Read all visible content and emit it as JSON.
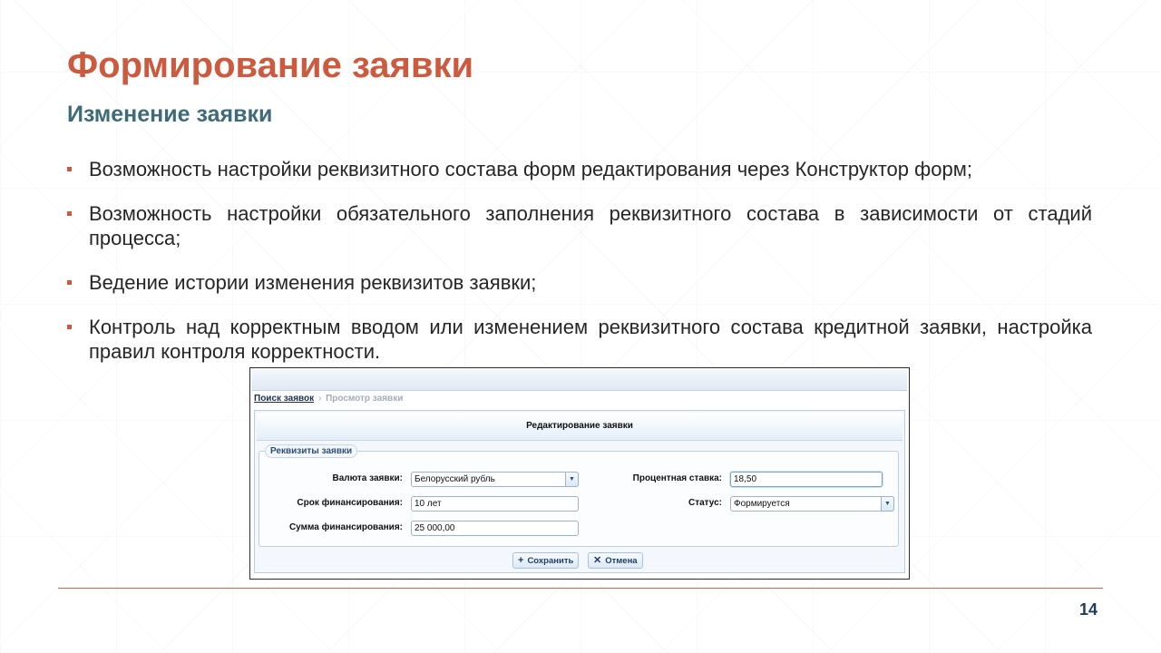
{
  "slide": {
    "title": "Формирование заявки",
    "subtitle": "Изменение заявки",
    "bullets": [
      "Возможность настройки реквизитного состава форм редактирования через Конструктор форм;",
      "Возможность настройки обязательного заполнения реквизитного состава в зависимости от стадий процесса;",
      "Ведение истории изменения реквизитов заявки;",
      "Контроль над корректным вводом или изменением реквизитного состава кредитной заявки, настройка правил контроля корректности."
    ],
    "page_number": "14"
  },
  "screenshot": {
    "breadcrumb": {
      "link": "Поиск заявок",
      "separator": "›",
      "current": "Просмотр заявки"
    },
    "panel_title": "Редактирование заявки",
    "fieldset_legend": "Реквизиты заявки",
    "fields": {
      "currency": {
        "label": "Валюта заявки:",
        "value": "Белорусский рубль"
      },
      "term": {
        "label": "Срок финансирования:",
        "value": "10 лет"
      },
      "amount": {
        "label": "Сумма финансирования:",
        "value": "25 000,00"
      },
      "rate": {
        "label": "Процентная ставка:",
        "value": "18,50"
      },
      "status": {
        "label": "Статус:",
        "value": "Формируется"
      }
    },
    "buttons": {
      "save": {
        "label": "Сохранить",
        "icon": "plus-icon"
      },
      "cancel": {
        "label": "Отмена",
        "icon": "cross-icon"
      }
    }
  }
}
